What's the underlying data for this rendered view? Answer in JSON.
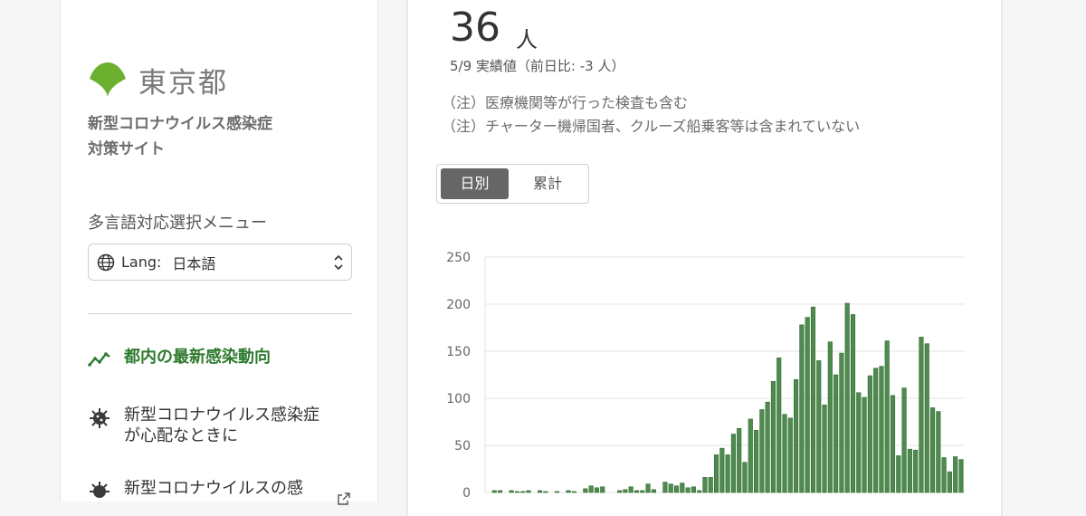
{
  "sidebar": {
    "logo_text": "東京都",
    "site_title_line1": "新型コロナウイルス感染症",
    "site_title_line2": "対策サイト",
    "lang_label": "多言語対応選択メニュー",
    "lang_prefix": "Lang:",
    "lang_value": "日本語",
    "nav": [
      {
        "label": "都内の最新感染動向",
        "icon": "trend-line-icon",
        "active": true
      },
      {
        "label_line1": "新型コロナウイルス感染症",
        "label_line2": "が心配なときに",
        "icon": "virus-icon"
      },
      {
        "label": "新型コロナウイルスの感",
        "icon": "virus-icon",
        "external_icon": "external-link-icon"
      }
    ]
  },
  "main": {
    "count_value": "36",
    "count_unit": "人",
    "count_sub": "5/9 実績値（前日比: -3 人）",
    "note1": "（注）医療機関等が行った検査も含む",
    "note2": "（注）チャーター機帰国者、クルーズ船乗客等は含まれていない",
    "toggle_daily": "日別",
    "toggle_cumulative": "累計"
  },
  "colors": {
    "bar": "#4f8a4f",
    "bar_outline": "#2f6a2f",
    "accent_green": "#2d7a2d",
    "logo_green": "#6bb02f"
  },
  "chart_data": {
    "type": "bar",
    "ylim": [
      0,
      250
    ],
    "yticks": [
      "250",
      "200",
      "150",
      "100",
      "50",
      "0"
    ],
    "grid": true,
    "values": [
      2,
      2,
      0,
      2,
      1,
      1,
      2,
      0,
      2,
      1,
      0,
      1,
      0,
      2,
      1,
      0,
      4,
      7,
      5,
      6,
      0,
      0,
      2,
      3,
      6,
      2,
      2,
      9,
      3,
      0,
      11,
      9,
      7,
      10,
      5,
      6,
      2,
      16,
      16,
      40,
      47,
      40,
      62,
      68,
      32,
      78,
      66,
      88,
      96,
      118,
      143,
      83,
      79,
      120,
      178,
      186,
      197,
      140,
      93,
      160,
      125,
      148,
      201,
      189,
      106,
      101,
      124,
      132,
      134,
      161,
      103,
      39,
      111,
      46,
      45,
      165,
      158,
      90,
      86,
      37,
      22,
      38,
      35
    ]
  }
}
